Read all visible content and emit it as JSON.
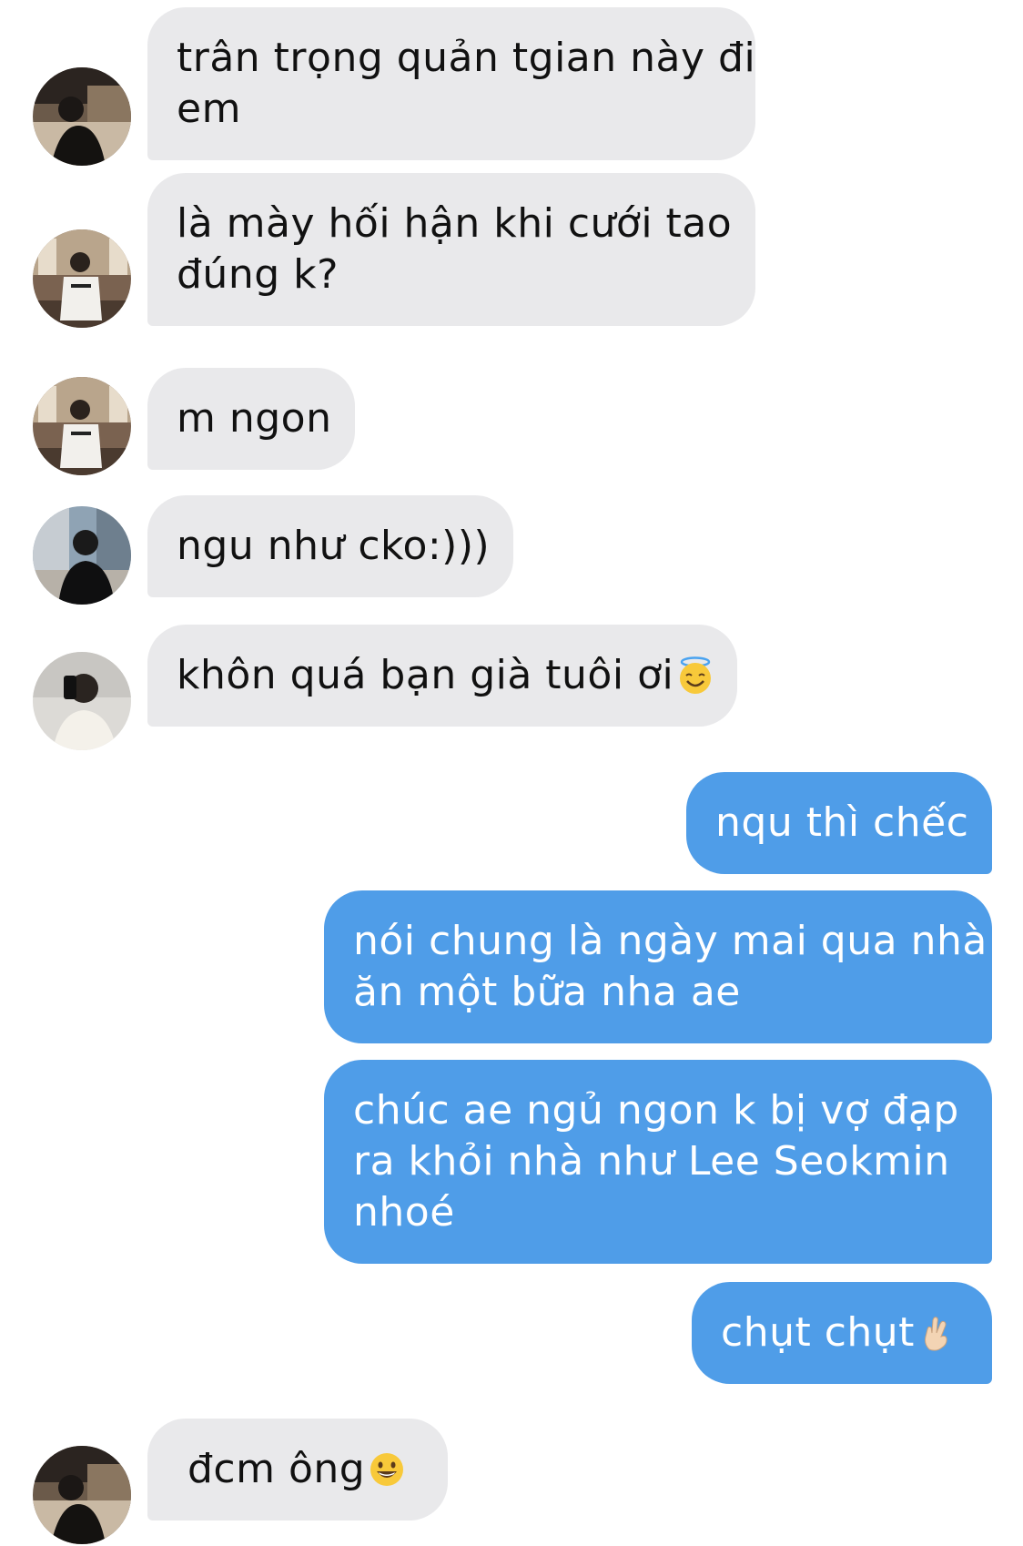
{
  "colors": {
    "incoming_bubble": "#e9e9eb",
    "outgoing_bubble": "#4f9de8",
    "incoming_text": "#111111",
    "outgoing_text": "#ffffff"
  },
  "messages": [
    {
      "direction": "in",
      "avatar": "avatar-photo-1",
      "text": "trân trọng quản tgian này đi",
      "text2": "em"
    },
    {
      "direction": "in",
      "avatar": "avatar-photo-2",
      "text": "là mày hối hận khi cưới tao",
      "text2": "đúng k?"
    },
    {
      "direction": "in",
      "avatar": "avatar-photo-2",
      "text": "m ngon"
    },
    {
      "direction": "in",
      "avatar": "avatar-photo-3",
      "text": "ngu như cko:)))"
    },
    {
      "direction": "in",
      "avatar": "avatar-photo-4",
      "text": "khôn quá bạn già tuôi ơi",
      "emoji": "smiling-face-with-halo-icon"
    },
    {
      "direction": "out",
      "text": "nqu thì chếc"
    },
    {
      "direction": "out",
      "text": "nói chung là ngày mai qua nhà",
      "text2": "ăn một bữa nha ae"
    },
    {
      "direction": "out",
      "text": "chúc ae ngủ ngon k bị vợ đạp",
      "text2": "ra khỏi nhà như Lee Seokmin",
      "text3": "nhoé"
    },
    {
      "direction": "out",
      "text": "chụt chụt",
      "emoji": "hand-with-index-and-middle-fingers-crossed-icon"
    },
    {
      "direction": "in",
      "avatar": "avatar-photo-1",
      "text": "đcm ông",
      "emoji": "grinning-face-icon"
    }
  ]
}
